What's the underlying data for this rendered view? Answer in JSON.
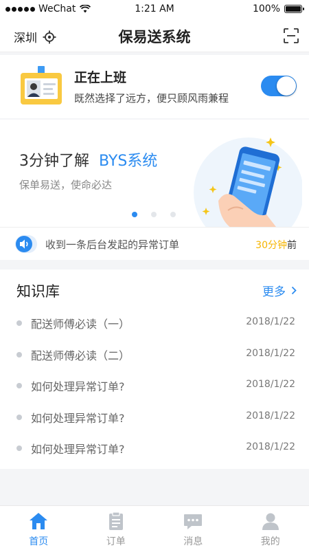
{
  "status_bar": {
    "carrier": "WeChat",
    "time": "1:21 AM",
    "battery": "100%",
    "battery_level": 1.0
  },
  "nav": {
    "city": "深圳",
    "title": "保易送系统",
    "icons": {
      "locate": "locate-icon",
      "scan": "scan-icon"
    }
  },
  "work_status": {
    "title": "正在上班",
    "subtitle": "既然选择了远方，便只顾风雨兼程",
    "toggle_on": true
  },
  "banner": {
    "title_prefix": "3分钟了解",
    "title_accent": "BYS系统",
    "subtitle": "保单易送，使命必达",
    "page_count": 3,
    "active_page": 1
  },
  "notice": {
    "text": "收到一条后台发起的异常订单",
    "time_value": "30分钟",
    "time_suffix": "前"
  },
  "knowledge": {
    "title": "知识库",
    "more_label": "更多",
    "items": [
      {
        "title": "配送师傅必读（一）",
        "date": "2018/1/22"
      },
      {
        "title": "配送师傅必读（二）",
        "date": "2018/1/22"
      },
      {
        "title": "如何处理异常订单?",
        "date": "2018/1/22"
      },
      {
        "title": "如何处理异常订单?",
        "date": "2018/1/22"
      },
      {
        "title": "如何处理异常订单?",
        "date": "2018/1/22"
      }
    ]
  },
  "tabs": [
    {
      "label": "首页",
      "icon": "home-icon",
      "active": true
    },
    {
      "label": "订单",
      "icon": "order-icon",
      "active": false
    },
    {
      "label": "消息",
      "icon": "message-icon",
      "active": false
    },
    {
      "label": "我的",
      "icon": "profile-icon",
      "active": false
    }
  ],
  "colors": {
    "accent": "#2b8bf0",
    "highlight": "#f5b400",
    "badge": "#f9c941"
  }
}
